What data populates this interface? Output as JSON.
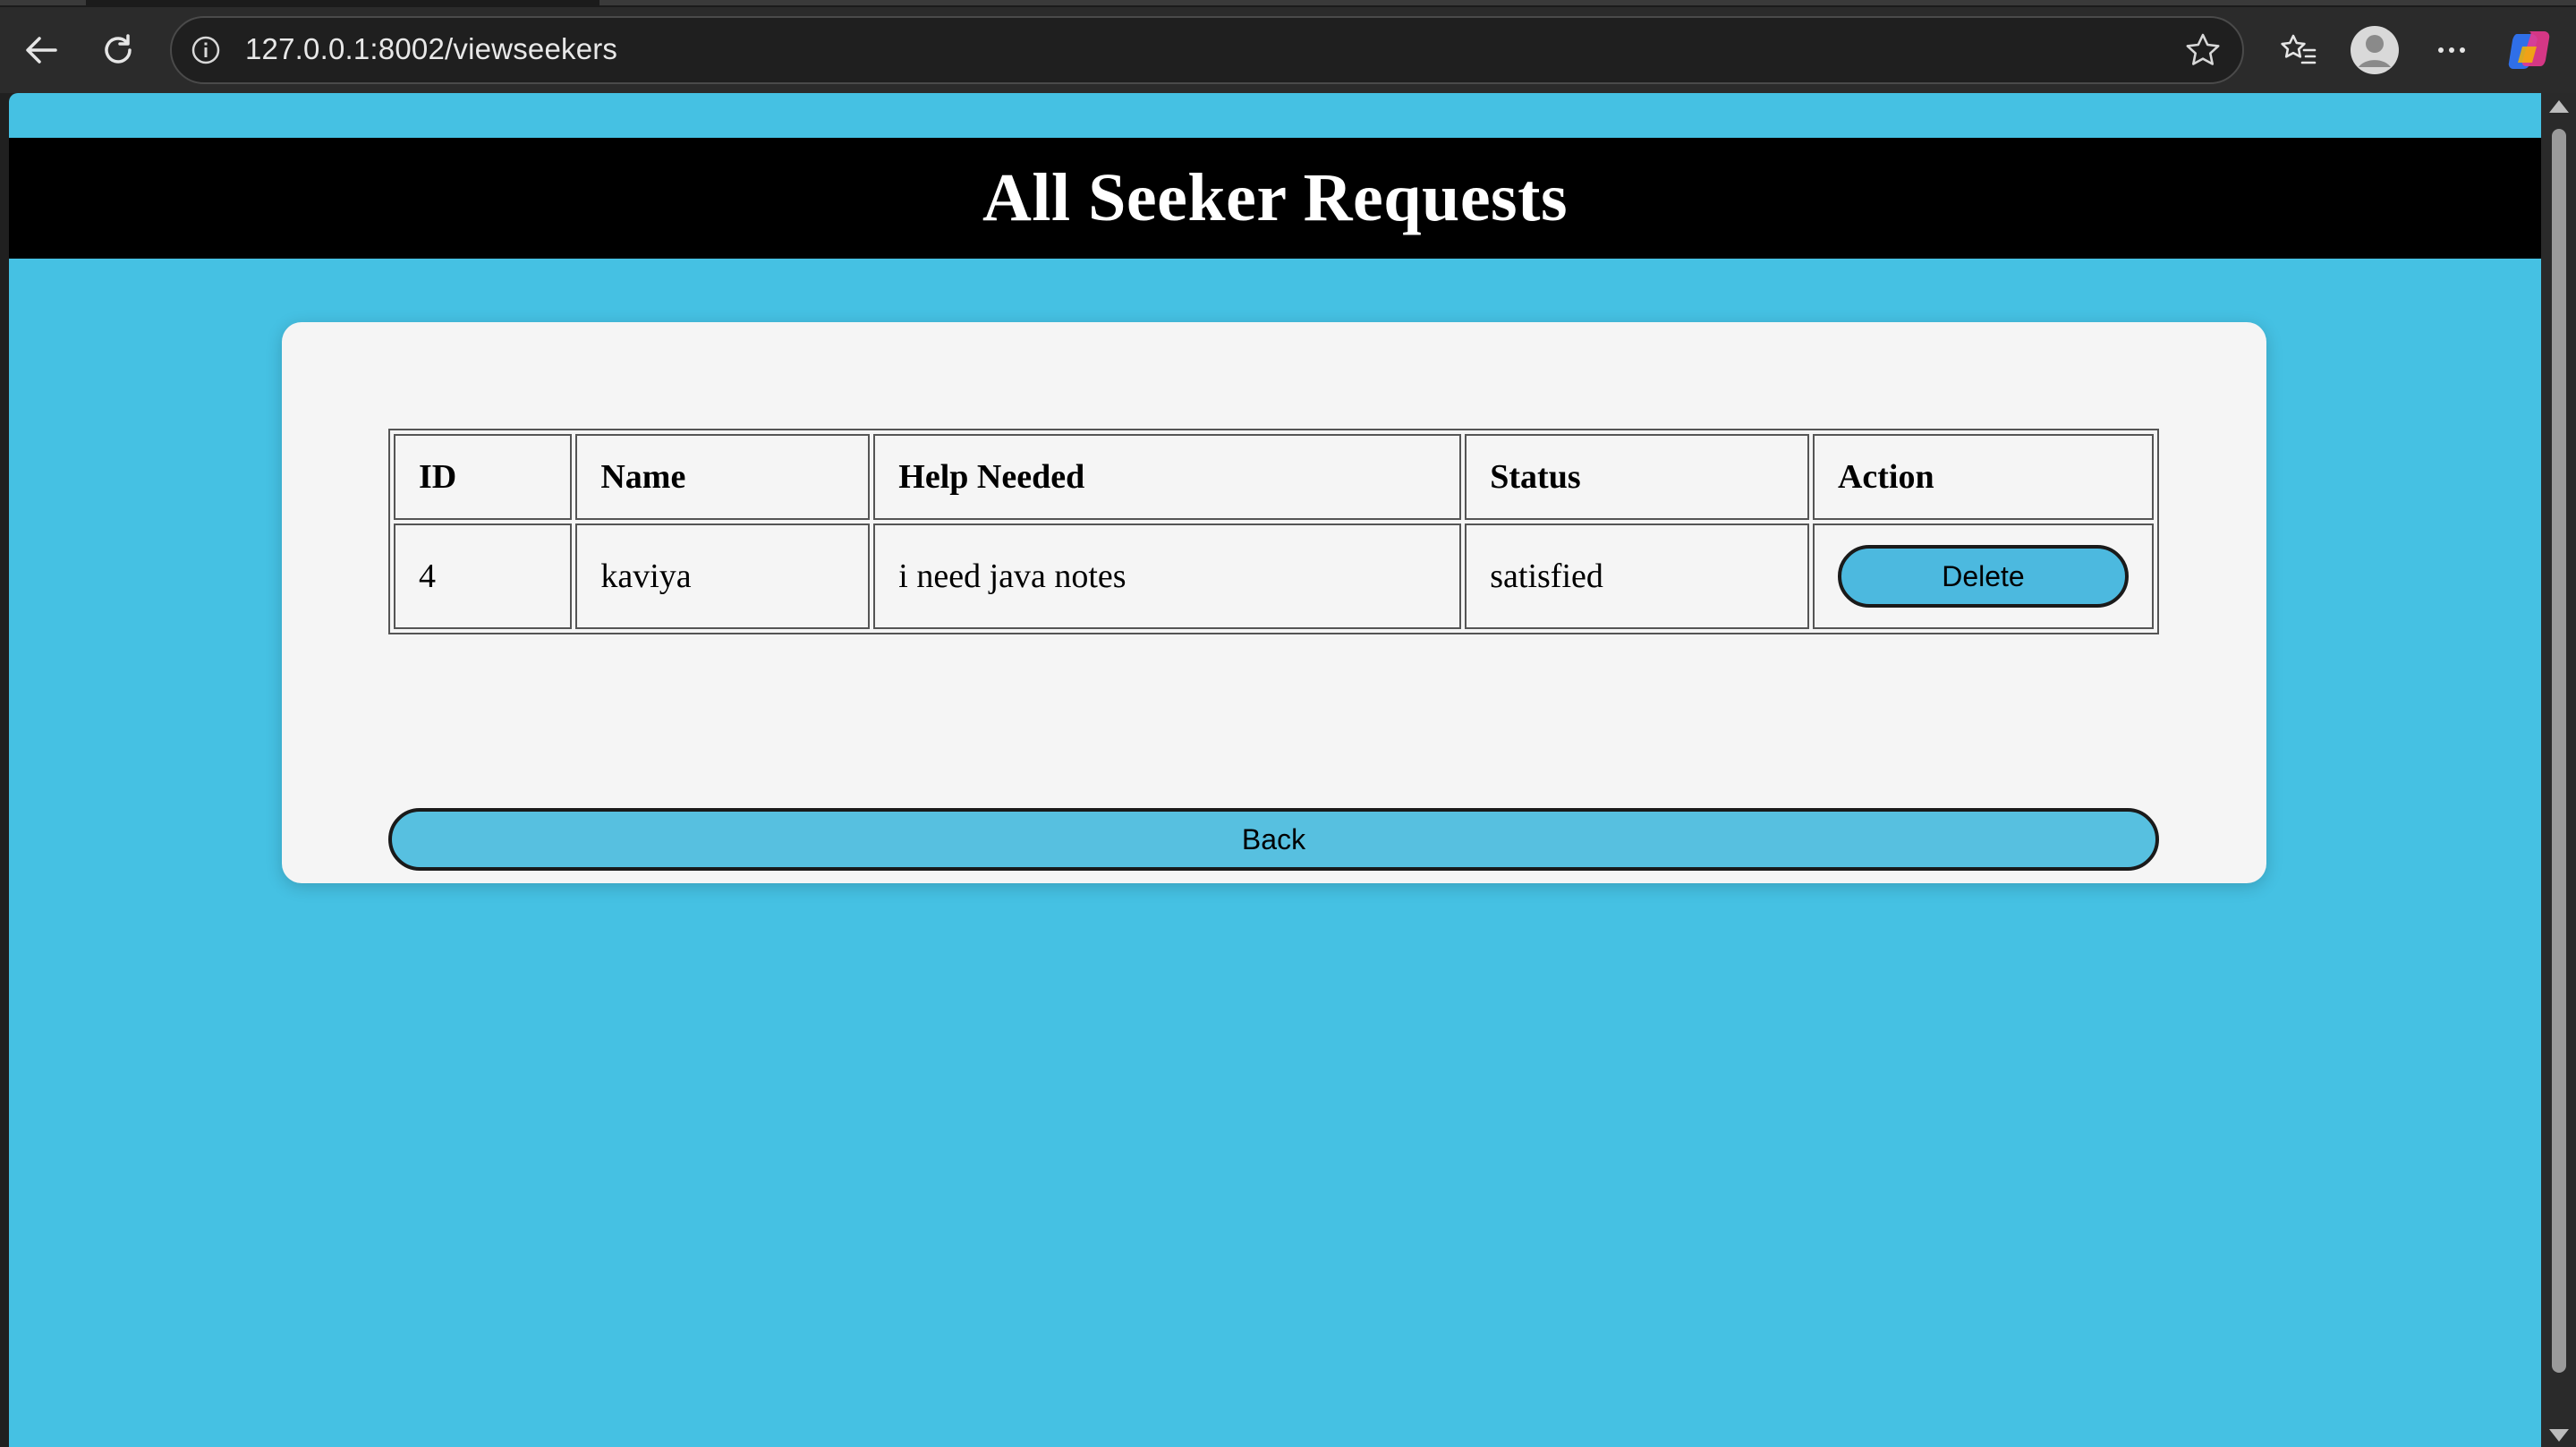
{
  "browser": {
    "url": "127.0.0.1:8002/viewseekers",
    "icons": [
      "back-arrow-icon",
      "reload-icon",
      "site-info-icon",
      "favorite-star-icon",
      "favorites-list-icon",
      "profile-avatar-icon",
      "more-options-icon",
      "copilot-icon"
    ]
  },
  "page": {
    "title": "All Seeker Requests",
    "colors": {
      "background": "#45c1e3",
      "header": "#000000",
      "card": "#f5f5f5",
      "button": "#4cb9df"
    }
  },
  "table": {
    "headers": [
      "ID",
      "Name",
      "Help Needed",
      "Status",
      "Action"
    ],
    "rows": [
      {
        "id": "4",
        "name": "kaviya",
        "help": "i need java notes",
        "status": "satisfied",
        "action_label": "Delete"
      }
    ]
  },
  "back_button": {
    "label": "Back"
  }
}
